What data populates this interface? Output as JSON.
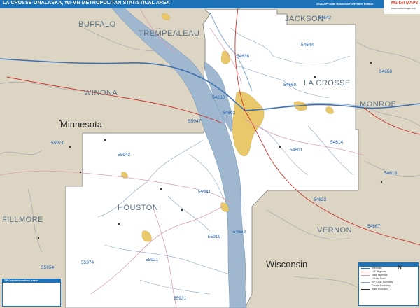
{
  "header": {
    "title": "LA CROSSE-ONALASKA, WI-MN METROPOLITAN STATISTICAL AREA",
    "edition": "2025 ZIP Code Business Reference Edition",
    "logo": "Market MAPS",
    "logo_url": "www.marketmaps.com"
  },
  "colors": {
    "title_bar": "#1e73b8",
    "land_outside": "#dcd5c4",
    "land_inside": "#ffffff",
    "water": "#9fb7cf",
    "urban": "#e8c86a",
    "zip_text": "#1d5fb0",
    "county_text": "#5a6f80",
    "interstate": "#3f6fb0",
    "us_highway": "#c9352e",
    "state_highway": "#d9a0b4"
  },
  "map": {
    "counties": [
      "BUFFALO",
      "TREMPEALEAU",
      "JACKSON",
      "WINONA",
      "LA CROSSE",
      "MONROE",
      "HOUSTON",
      "FILLMORE",
      "VERNON"
    ],
    "states": [
      "Minnesota",
      "Wisconsin"
    ],
    "zip_codes": [
      "54642",
      "54644",
      "54636",
      "54669",
      "54658",
      "54650",
      "54603",
      "55947",
      "54601",
      "54614",
      "55971",
      "55943",
      "54619",
      "55941",
      "54623",
      "54667",
      "54658",
      "55919",
      "55974",
      "55921",
      "55954",
      "55931"
    ],
    "icons": [
      "compass-icon",
      "city-marker-icon"
    ]
  },
  "legend": {
    "left_title": "ZIP Code Information Locator",
    "right_items": [
      "Interstate",
      "U.S. Highway",
      "State Highway",
      "County Road",
      "ZIP Code Boundary",
      "County Boundary",
      "State Boundary"
    ],
    "compass_label": "N"
  }
}
